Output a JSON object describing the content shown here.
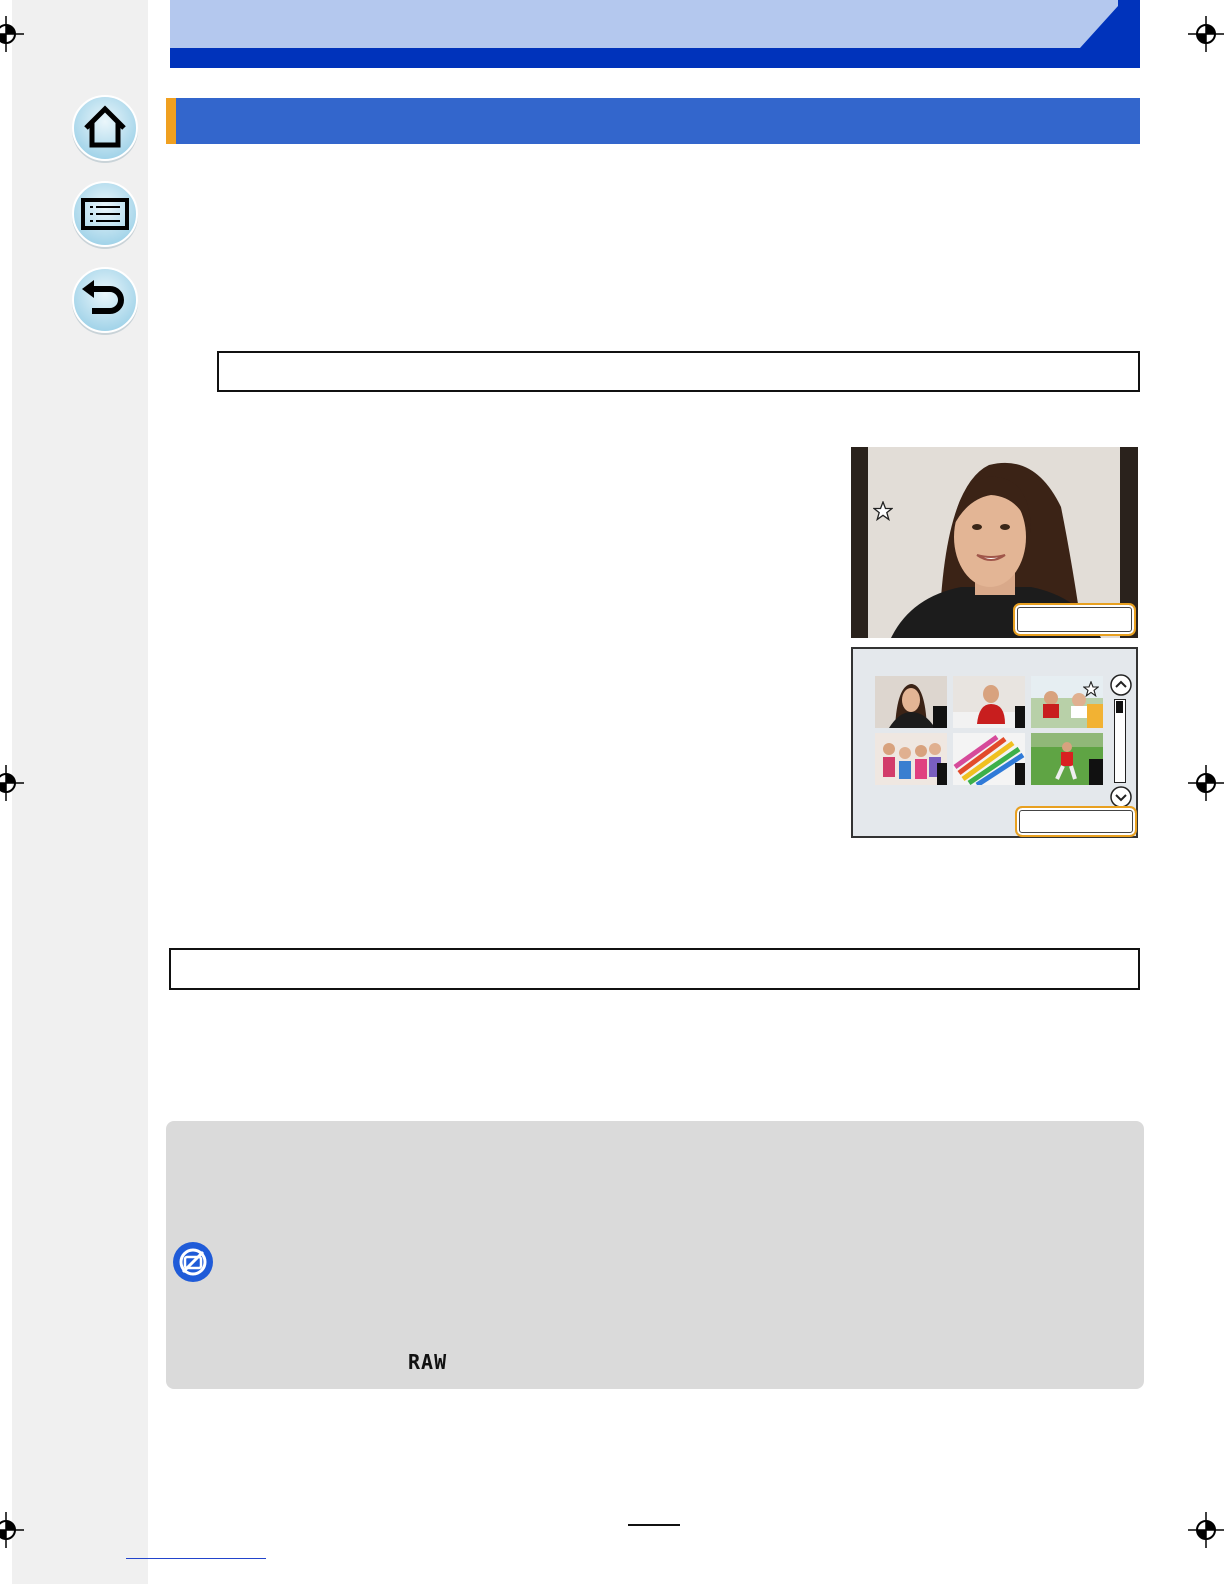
{
  "navigation": {
    "home_icon": "home-icon",
    "contents_icon": "list-icon",
    "back_icon": "return-icon"
  },
  "colors": {
    "header_light": "#b4c8ee",
    "header_dark": "#0033bb",
    "section_bar": "#3366cc",
    "section_accent": "#f0a020",
    "note_panel": "#dadada",
    "note_icon": "#1f5bd8"
  },
  "figure": {
    "rating_icon": "star-outline-icon",
    "scroll_up_icon": "chevron-up-icon",
    "scroll_down_icon": "chevron-down-icon"
  },
  "note": {
    "icon": "not-available-icon",
    "raw_label": "RAW"
  }
}
